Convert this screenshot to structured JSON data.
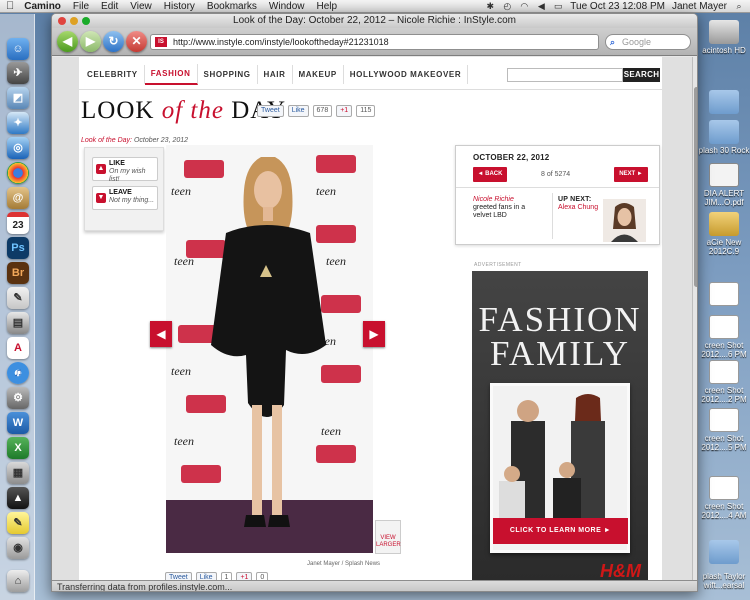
{
  "menubar": {
    "app_name": "Camino",
    "menus": [
      "File",
      "Edit",
      "View",
      "History",
      "Bookmarks",
      "Window",
      "Help"
    ],
    "clock": "Tue Oct 23  12:08 PM",
    "user": "Janet Mayer"
  },
  "desktop": {
    "icons": [
      {
        "label": "acintosh HD",
        "kind": "drive"
      },
      {
        "label": "",
        "kind": "folder"
      },
      {
        "label": "plash 30 Rock",
        "kind": "folder"
      },
      {
        "label": "DIA ALERT JIM...O.pdf",
        "kind": "doc"
      },
      {
        "label": "aCie New 2012C.9",
        "kind": "zip"
      },
      {
        "label": "",
        "kind": "shot"
      },
      {
        "label": "creen Shot 2012....6 PM",
        "kind": "shot"
      },
      {
        "label": "creen Shot 2012....2 PM",
        "kind": "shot"
      },
      {
        "label": "creen Shot 2012....5 PM",
        "kind": "shot"
      },
      {
        "label": "creen Shot 2012....4 AM",
        "kind": "shot"
      },
      {
        "label": "",
        "kind": "folder"
      },
      {
        "label": "plash Taylor wift...earsal",
        "kind": "folder"
      }
    ]
  },
  "window": {
    "title": "Look of the Day: October 22, 2012 – Nicole Richie : InStyle.com",
    "url": "http://www.instyle.com/instyle/lookoftheday#21231018",
    "search_placeholder": "Google",
    "status": "Transferring data from profiles.instyle.com..."
  },
  "site": {
    "nav": [
      "CELEBRITY",
      "FASHION",
      "SHOPPING",
      "HAIR",
      "MAKEUP",
      "HOLLYWOOD MAKEOVER"
    ],
    "search_button": "SEARCH",
    "title_a": "LOOK ",
    "title_b": "of the",
    "title_c": " DAY",
    "share": {
      "tweet": "Tweet",
      "like": "Like",
      "like_count": "678",
      "gplus": "+1",
      "gplus_count": "115"
    },
    "date_label": "Look of the Day:",
    "date": "October 23, 2012",
    "like_btn": {
      "title": "LIKE",
      "sub": "On my wish list!"
    },
    "leave_btn": {
      "title": "LEAVE",
      "sub": "Not my thing..."
    },
    "view_larger": "VIEW LARGER",
    "credit": "Janet Mayer / Splash News",
    "bottom_share": {
      "tweet": "Tweet",
      "like": "Like",
      "like_count": "1",
      "gplus": "+1",
      "gplus_count": "0"
    },
    "gallery": {
      "date": "OCTOBER 22, 2012",
      "back": "◄ BACK",
      "next": "NEXT ►",
      "count": "8 of 5274",
      "celeb": "Nicole Richie",
      "caption": "greeted fans in a velvet LBD",
      "up_next_label": "UP NEXT:",
      "up_next_name": "Alexa Chung"
    },
    "ad": {
      "label": "ADVERTISEMENT",
      "headline": "FASHION FAMILY",
      "cta": "CLICK TO LEARN MORE ►",
      "brand": "H&M"
    }
  }
}
